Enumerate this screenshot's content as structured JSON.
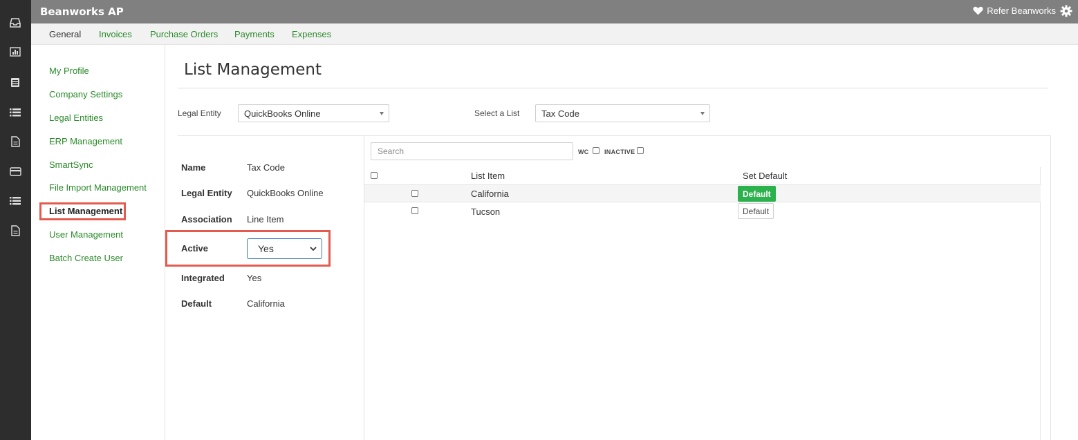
{
  "app": {
    "title": "Beanworks AP",
    "refer_label": "Refer Beanworks"
  },
  "rail_icons": [
    "inbox-icon",
    "chart-icon",
    "document-list-icon",
    "list-icon",
    "file-icon",
    "credit-card-icon",
    "list-icon",
    "file-icon"
  ],
  "tabs": [
    {
      "label": "General",
      "active": true
    },
    {
      "label": "Invoices"
    },
    {
      "label": "Purchase Orders"
    },
    {
      "label": "Payments"
    },
    {
      "label": "Expenses"
    }
  ],
  "settings_nav": [
    {
      "label": "My Profile"
    },
    {
      "label": "Company Settings"
    },
    {
      "label": "Legal Entities"
    },
    {
      "label": "ERP Management"
    },
    {
      "label": "SmartSync"
    },
    {
      "label": "File Import Management"
    },
    {
      "label": "List Management",
      "current": true
    },
    {
      "label": "User Management"
    },
    {
      "label": "Batch Create User"
    }
  ],
  "page": {
    "title": "List Management"
  },
  "filters": {
    "legal_entity_label": "Legal Entity",
    "legal_entity_value": "QuickBooks Online",
    "list_label": "Select a List",
    "list_value": "Tax Code"
  },
  "detail": {
    "name_label": "Name",
    "name_value": "Tax Code",
    "entity_label": "Legal Entity",
    "entity_value": "QuickBooks Online",
    "association_label": "Association",
    "association_value": "Line Item",
    "active_label": "Active",
    "active_value": "Yes",
    "integrated_label": "Integrated",
    "integrated_value": "Yes",
    "default_label": "Default",
    "default_value": "California"
  },
  "list": {
    "search_placeholder": "Search",
    "wc_label": "WC",
    "inactive_label": "INACTIVE",
    "headers": {
      "item": "List Item",
      "set_default": "Set Default"
    },
    "rows": [
      {
        "item": "California",
        "button": "Default",
        "is_default": true
      },
      {
        "item": "Tucson",
        "button": "Default",
        "is_default": false
      }
    ]
  },
  "colors": {
    "accent_green": "#2bb24c",
    "link_green": "#2a8a2a",
    "highlight": "#e55a4f",
    "header_gray": "#808080",
    "rail": "#2d2d2d"
  }
}
